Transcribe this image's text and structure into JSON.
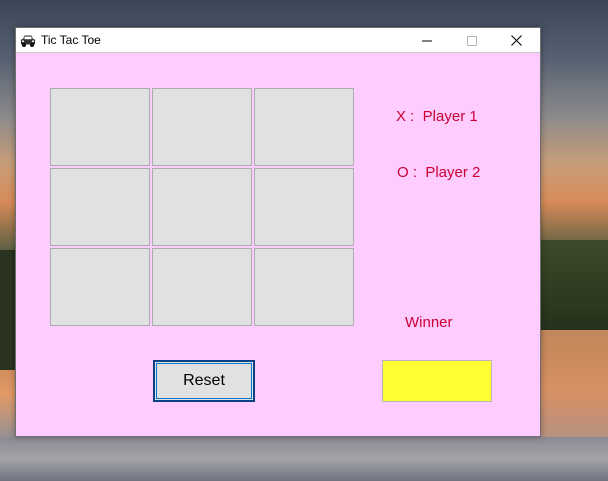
{
  "window": {
    "title": "Tic Tac Toe",
    "icon": "car-icon",
    "controls": [
      "minimize",
      "maximize",
      "close"
    ]
  },
  "board": {
    "cells": [
      "",
      "",
      "",
      "",
      "",
      "",
      "",
      "",
      ""
    ]
  },
  "players": {
    "x_label": "X :  Player 1",
    "o_label": "O :  Player 2"
  },
  "winner": {
    "label": "Winner",
    "value": ""
  },
  "reset_button": {
    "label": "Reset"
  },
  "colors": {
    "client_background": "#ffccff",
    "label_text": "#cc0033",
    "winner_box": "#ffff33",
    "cell_background": "#e1e1e1"
  }
}
